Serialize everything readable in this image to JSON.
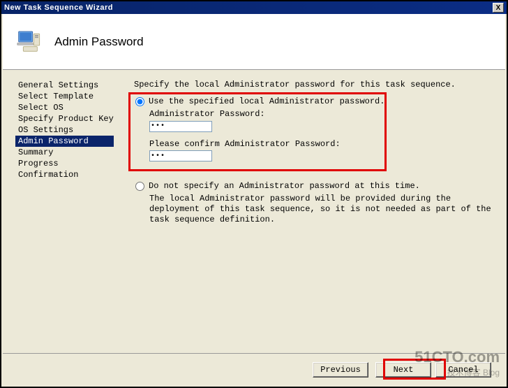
{
  "window": {
    "title": "New Task Sequence Wizard",
    "close_label": "X"
  },
  "header": {
    "title": "Admin Password"
  },
  "sidebar": {
    "items": [
      {
        "label": "General Settings",
        "selected": false
      },
      {
        "label": "Select Template",
        "selected": false
      },
      {
        "label": "Select OS",
        "selected": false
      },
      {
        "label": "Specify Product Key",
        "selected": false
      },
      {
        "label": "OS Settings",
        "selected": false
      },
      {
        "label": "Admin Password",
        "selected": true
      },
      {
        "label": "Summary",
        "selected": false
      },
      {
        "label": "Progress",
        "selected": false
      },
      {
        "label": "Confirmation",
        "selected": false
      }
    ]
  },
  "main": {
    "instruction": "Specify the local Administrator password for this task sequence.",
    "option1": {
      "label": "Use the specified local Administrator password.",
      "checked": true,
      "pw_label": "Administrator Password:",
      "pw_value": "●●●",
      "confirm_label": "Please confirm Administrator Password:",
      "confirm_value": "●●●"
    },
    "option2": {
      "label": "Do not specify an Administrator password at this time.",
      "checked": false,
      "description": "The local Administrator password will be provided during the deployment of this task sequence, so it is not needed as part of the task sequence definition."
    }
  },
  "footer": {
    "previous": "Previous",
    "next": "Next",
    "cancel": "Cancel"
  },
  "watermark": {
    "big": "51CTO.com",
    "small": "技术博客   Blog"
  }
}
